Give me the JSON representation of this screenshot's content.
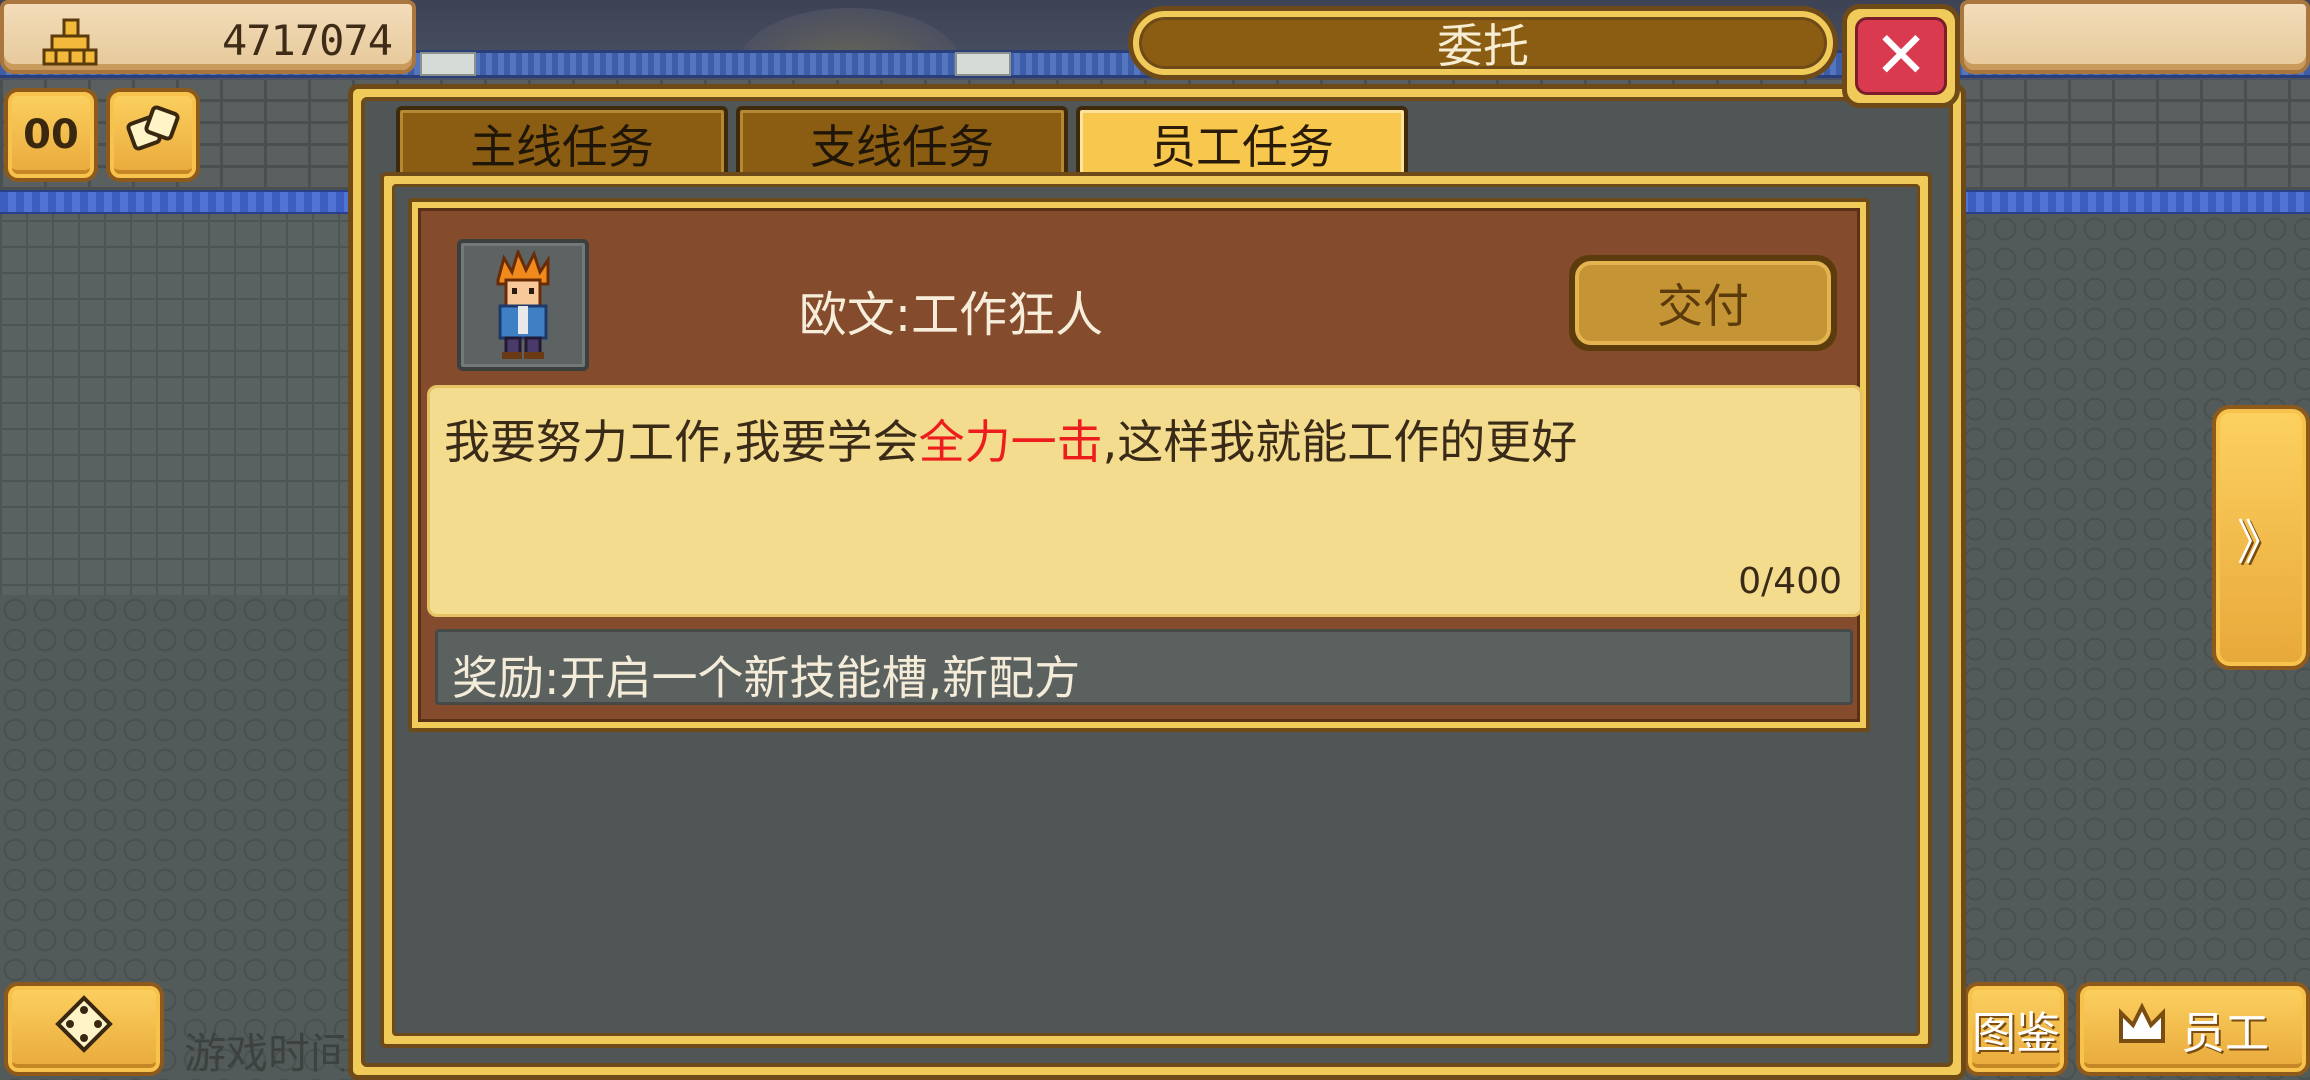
{
  "hud": {
    "gold_icon": "gold-stack-icon",
    "gold_value": "4717074",
    "pause_label": "00",
    "speed_icon": "dice-icon",
    "map_icon": "dpad-icon",
    "game_time_label": "游戏时间",
    "encyclopedia_label": "图鉴",
    "staff_label": "员工",
    "staff_icon": "crown-icon",
    "side_arrow_label": "》"
  },
  "dialog": {
    "title": "委托",
    "close_symbol": "✕",
    "tabs": [
      {
        "label": "主线任务",
        "active": false
      },
      {
        "label": "支线任务",
        "active": false
      },
      {
        "label": "员工任务",
        "active": true
      }
    ],
    "task": {
      "name": "欧文:工作狂人",
      "deliver_label": "交付",
      "desc_before": "我要努力工作,我要学会",
      "desc_highlight": "全力一击",
      "desc_after": ",这样我就能工作的更好",
      "progress": "0/400",
      "reward": "奖励:开启一个新技能槽,新配方"
    }
  },
  "colors": {
    "highlight": "#ee1d1d",
    "gold_button": "#f0cb5a",
    "card_brown": "#844b2d",
    "desc_bg": "#f4dc8e",
    "close_red": "#d93a4f"
  }
}
